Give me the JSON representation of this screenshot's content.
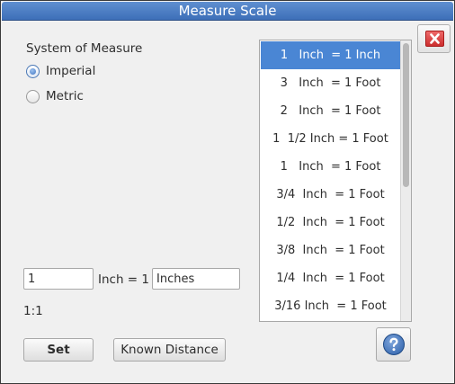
{
  "window": {
    "title": "Measure Scale"
  },
  "system": {
    "label": "System of Measure",
    "options": [
      {
        "label": "Imperial",
        "checked": true
      },
      {
        "label": "Metric",
        "checked": false
      }
    ]
  },
  "scale_list": {
    "items": [
      "1   Inch  = 1 Inch",
      "3   Inch  = 1 Foot",
      "2   Inch  = 1 Foot",
      "1  1/2 Inch = 1 Foot",
      "1   Inch  = 1 Foot",
      "3/4  Inch  = 1 Foot",
      "1/2  Inch  = 1 Foot",
      "3/8  Inch  = 1 Foot",
      "1/4  Inch  = 1 Foot",
      "3/16 Inch  = 1 Foot"
    ],
    "selected_index": 0
  },
  "scale_entry": {
    "value": "1",
    "middle_label": "Inch = 1",
    "unit_value": "Inches",
    "ratio": "1:1"
  },
  "buttons": {
    "set": "Set",
    "known_distance": "Known Distance"
  },
  "icons": {
    "close": "close-icon",
    "help": "help-icon"
  },
  "colors": {
    "titlebar": "#4a7cc2",
    "selection": "#4a86d4",
    "close_red": "#dd3b3b"
  }
}
